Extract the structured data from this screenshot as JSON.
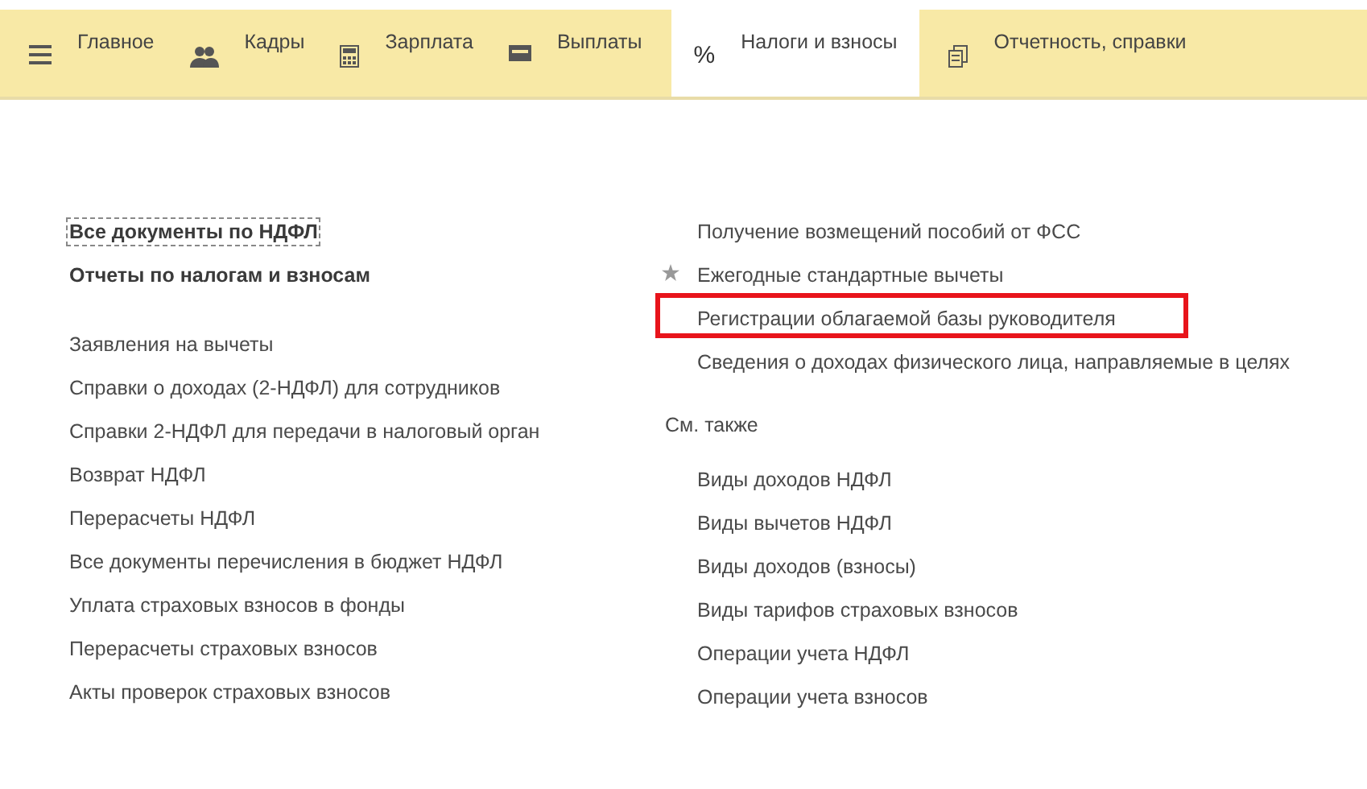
{
  "tabs": [
    {
      "label": "Главное",
      "selected": false
    },
    {
      "label": "Кадры",
      "selected": false
    },
    {
      "label": "Зарплата",
      "selected": false
    },
    {
      "label": "Выплаты",
      "selected": false
    },
    {
      "label": "Налоги и взносы",
      "selected": true,
      "glyph": "%"
    },
    {
      "label": "Отчетность, справки",
      "selected": false
    }
  ],
  "left_items": [
    {
      "label": "Все документы по НДФЛ",
      "kind": "heading",
      "focused": true
    },
    {
      "label": "Отчеты по налогам и взносам",
      "kind": "heading",
      "focused": false
    },
    {
      "label": "Заявления на вычеты",
      "kind": "link",
      "focused": false
    },
    {
      "label": "Справки о доходах (2-НДФЛ) для сотрудников",
      "kind": "link",
      "focused": false
    },
    {
      "label": "Справки 2-НДФЛ для передачи в налоговый орган",
      "kind": "link",
      "focused": false
    },
    {
      "label": "Возврат НДФЛ",
      "kind": "link",
      "focused": false
    },
    {
      "label": "Перерасчеты НДФЛ",
      "kind": "link",
      "focused": false
    },
    {
      "label": "Все документы перечисления в бюджет НДФЛ",
      "kind": "link",
      "focused": false
    },
    {
      "label": "Уплата страховых взносов в фонды",
      "kind": "link",
      "focused": false
    },
    {
      "label": "Перерасчеты страховых взносов",
      "kind": "link",
      "focused": false
    },
    {
      "label": "Акты проверок страховых взносов",
      "kind": "link",
      "focused": false
    }
  ],
  "right_items": [
    {
      "label": "Получение возмещений пособий от ФСС",
      "starred": false,
      "highlighted": false
    },
    {
      "label": "Ежегодные стандартные вычеты",
      "starred": true,
      "highlighted": false
    },
    {
      "label": "Регистрации облагаемой базы руководителя",
      "starred": false,
      "highlighted": true
    },
    {
      "label": "Сведения о доходах физического лица, направляемые в целях",
      "starred": false,
      "highlighted": false
    }
  ],
  "see_also": {
    "title": "См. также",
    "items": [
      {
        "label": "Виды доходов НДФЛ"
      },
      {
        "label": "Виды вычетов НДФЛ"
      },
      {
        "label": "Виды доходов (взносы)"
      },
      {
        "label": "Виды тарифов страховых взносов"
      },
      {
        "label": "Операции учета НДФЛ"
      },
      {
        "label": "Операции учета взносов"
      }
    ]
  }
}
